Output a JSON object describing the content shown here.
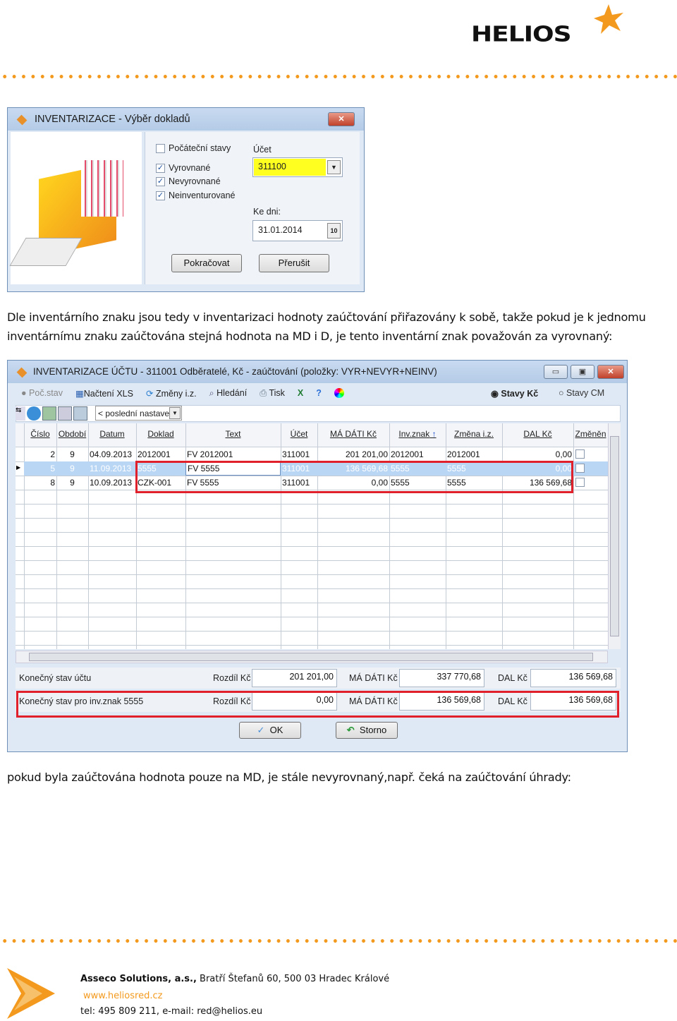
{
  "logo": {
    "text": "HELIOS",
    "accent": "#f39a1e"
  },
  "dialog1": {
    "title": "INVENTARIZACE - Výběr dokladů",
    "close": "✕",
    "checkboxes": [
      {
        "label": "Počáteční stavy",
        "checked": false
      },
      {
        "label": "Vyrovnané",
        "checked": true
      },
      {
        "label": "Nevyrovnané",
        "checked": true
      },
      {
        "label": "Neinventurované",
        "checked": true
      }
    ],
    "ucet_label": "Účet",
    "ucet_value": "311100",
    "date_label": "Ke dni:",
    "date_value": "31.01.2014",
    "calendar_day": "10",
    "continue": "Pokračovat",
    "cancel": "Přerušit"
  },
  "paragraph1": "Dle inventárního znaku jsou tedy v inventarizaci hodnoty zaúčtování přiřazovány k sobě, takže pokud je k jednomu inventárnímu znaku zaúčtována stejná hodnota na MD i D, je tento inventární znak považován za vyrovnaný:",
  "dialog2": {
    "title": "INVENTARIZACE ÚČTU - 311001  Odběratelé, Kč - zaúčtování  (položky: VYR+NEVYR+NEINV)",
    "toolbar": [
      "Poč.stav",
      "Načtení XLS",
      "Změny i.z.",
      "Hledání",
      "Tisk"
    ],
    "radio": [
      {
        "label": "Stavy Kč",
        "selected": true
      },
      {
        "label": "Stavy CM",
        "selected": false
      }
    ],
    "filter": "< poslední nastave",
    "columns": [
      "Číslo",
      "Období",
      "Datum",
      "Doklad",
      "Text",
      "Účet",
      "MÁ DÁTI  Kč",
      "Inv.znak",
      "Změna i.z.",
      "DAL  Kč",
      "Změněn"
    ],
    "rows": [
      [
        "2",
        "9",
        "04.09.2013",
        "2012001",
        "FV 2012001",
        "311001",
        "201 201,00",
        "2012001",
        "2012001",
        "0,00"
      ],
      [
        "5",
        "9",
        "11.09.2013",
        "5555",
        "FV 5555",
        "311001",
        "136 569,68",
        "5555",
        "5555",
        "0,00"
      ],
      [
        "8",
        "9",
        "10.09.2013",
        "CZK-001",
        "FV 5555",
        "311001",
        "0,00",
        "5555",
        "5555",
        "136 569,68"
      ]
    ],
    "selected_row": 1,
    "summary": [
      {
        "label": "Konečný stav účtu",
        "rozdil_label": "Rozdíl Kč",
        "rozdil": "201 201,00",
        "md_label": "MÁ DÁTI Kč",
        "md": "337 770,68",
        "dal_label": "DAL Kč",
        "dal": "136 569,68"
      },
      {
        "label": "Konečný stav pro inv.znak 5555",
        "rozdil_label": "Rozdíl Kč",
        "rozdil": "0,00",
        "md_label": "MÁ DÁTI Kč",
        "md": "136 569,68",
        "dal_label": "DAL Kč",
        "dal": "136 569,68"
      }
    ],
    "ok": "OK",
    "storno": "Storno",
    "highlight_color": "#e0202a"
  },
  "paragraph2": "pokud byla zaúčtována hodnota pouze na MD, je stále nevyrovnaný,např. čeká na zaúčtování úhrady:",
  "footer": {
    "company": "Asseco Solutions, a.s.,",
    "address": " Bratří Štefanů 60, 500 03 Hradec Králové",
    "web": "www.heliosred.cz",
    "contact": "tel: 495 809 211, e-mail: red@helios.eu"
  }
}
